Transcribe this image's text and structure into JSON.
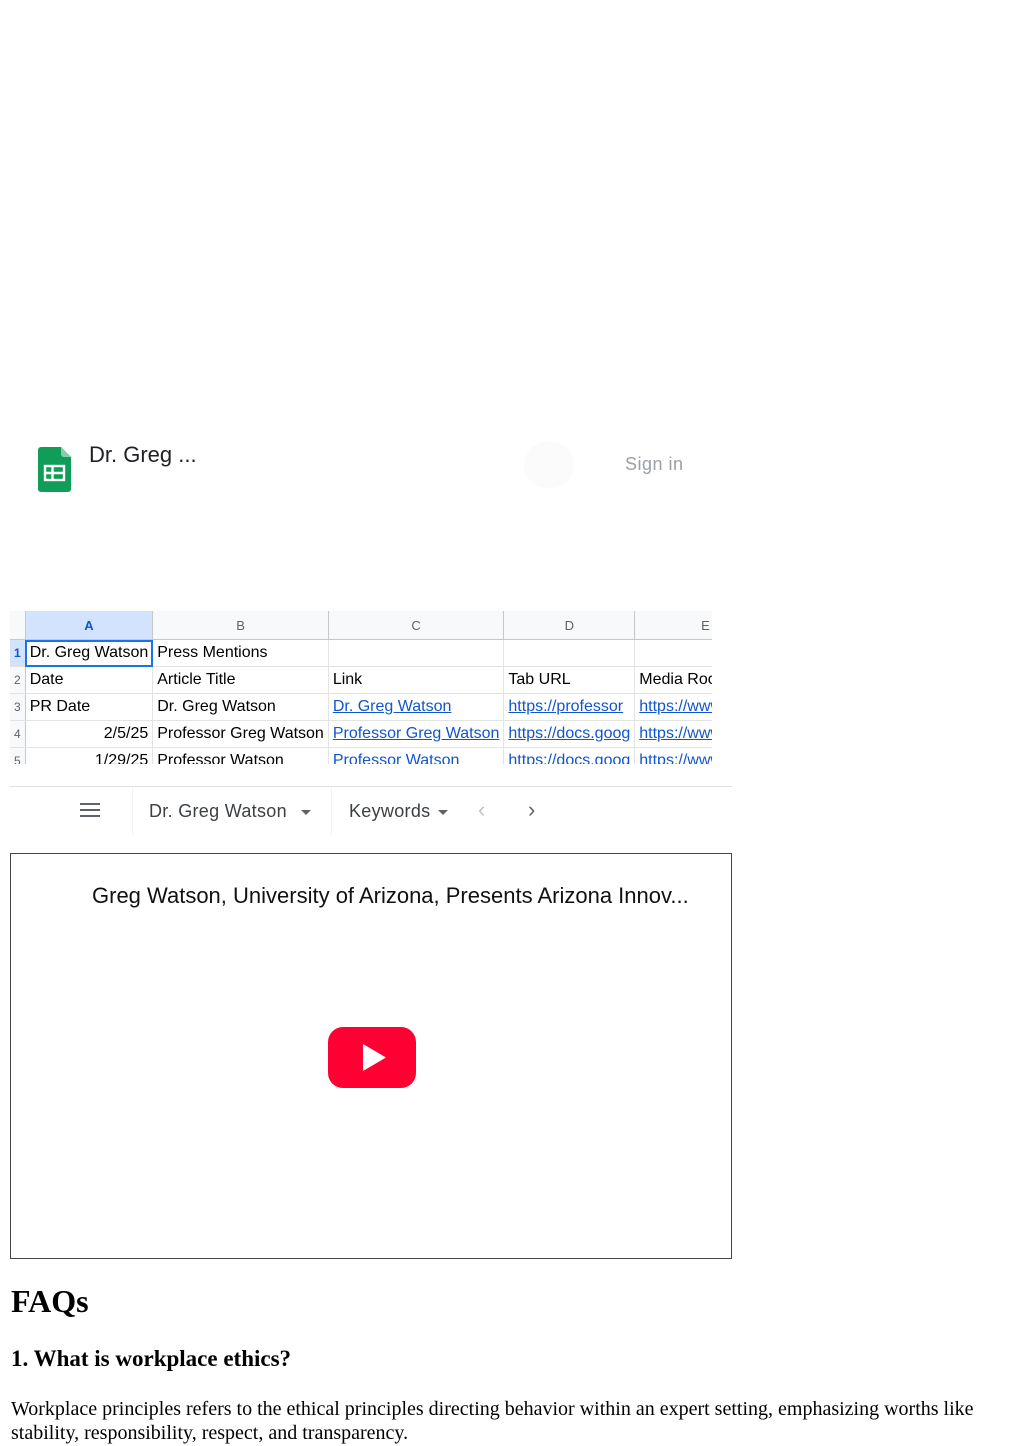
{
  "sheets": {
    "doc_title": "Dr. Greg ...",
    "sign_in": "Sign in",
    "logo_icon": "google-sheets-icon",
    "columns": [
      "A",
      "B",
      "C",
      "D",
      "E"
    ],
    "rows": [
      {
        "num": "1",
        "cells": [
          "Dr. Greg Watson",
          "Press Mentions",
          "",
          "",
          ""
        ]
      },
      {
        "num": "2",
        "cells": [
          "Date",
          "Article Title",
          "Link",
          "Tab URL",
          "Media Room Rank"
        ]
      },
      {
        "num": "3",
        "cells": [
          "PR Date",
          "Dr. Greg Watson",
          "Dr. Greg Watson",
          "https://professor",
          "https://www.pre"
        ]
      },
      {
        "num": "4",
        "cells": [
          "2/5/25",
          "Professor Greg Watson",
          "Professor Greg Watson",
          "https://docs.goog",
          "https://www.pre"
        ]
      },
      {
        "num": "5",
        "cells": [
          "1/29/25",
          "Professor Watson",
          "Professor Watson",
          "https://docs.goog",
          "https://www.pre"
        ]
      }
    ],
    "tabs": {
      "menu_icon": "menu-icon",
      "sheet1": "Dr. Greg Watson",
      "sheet2": "Keywords",
      "prev": "‹",
      "next": "›"
    }
  },
  "video": {
    "title": "Greg Watson, University of Arizona, Presents Arizona Innov...",
    "play_icon": "youtube-play-icon",
    "play_color": "#ff0033"
  },
  "faq": {
    "heading": "FAQs",
    "question": "1. What is workplace ethics?",
    "answer": "Workplace principles refers to the ethical principles directing behavior within an expert setting, emphasizing worths like stability, responsibility, respect, and transparency."
  }
}
